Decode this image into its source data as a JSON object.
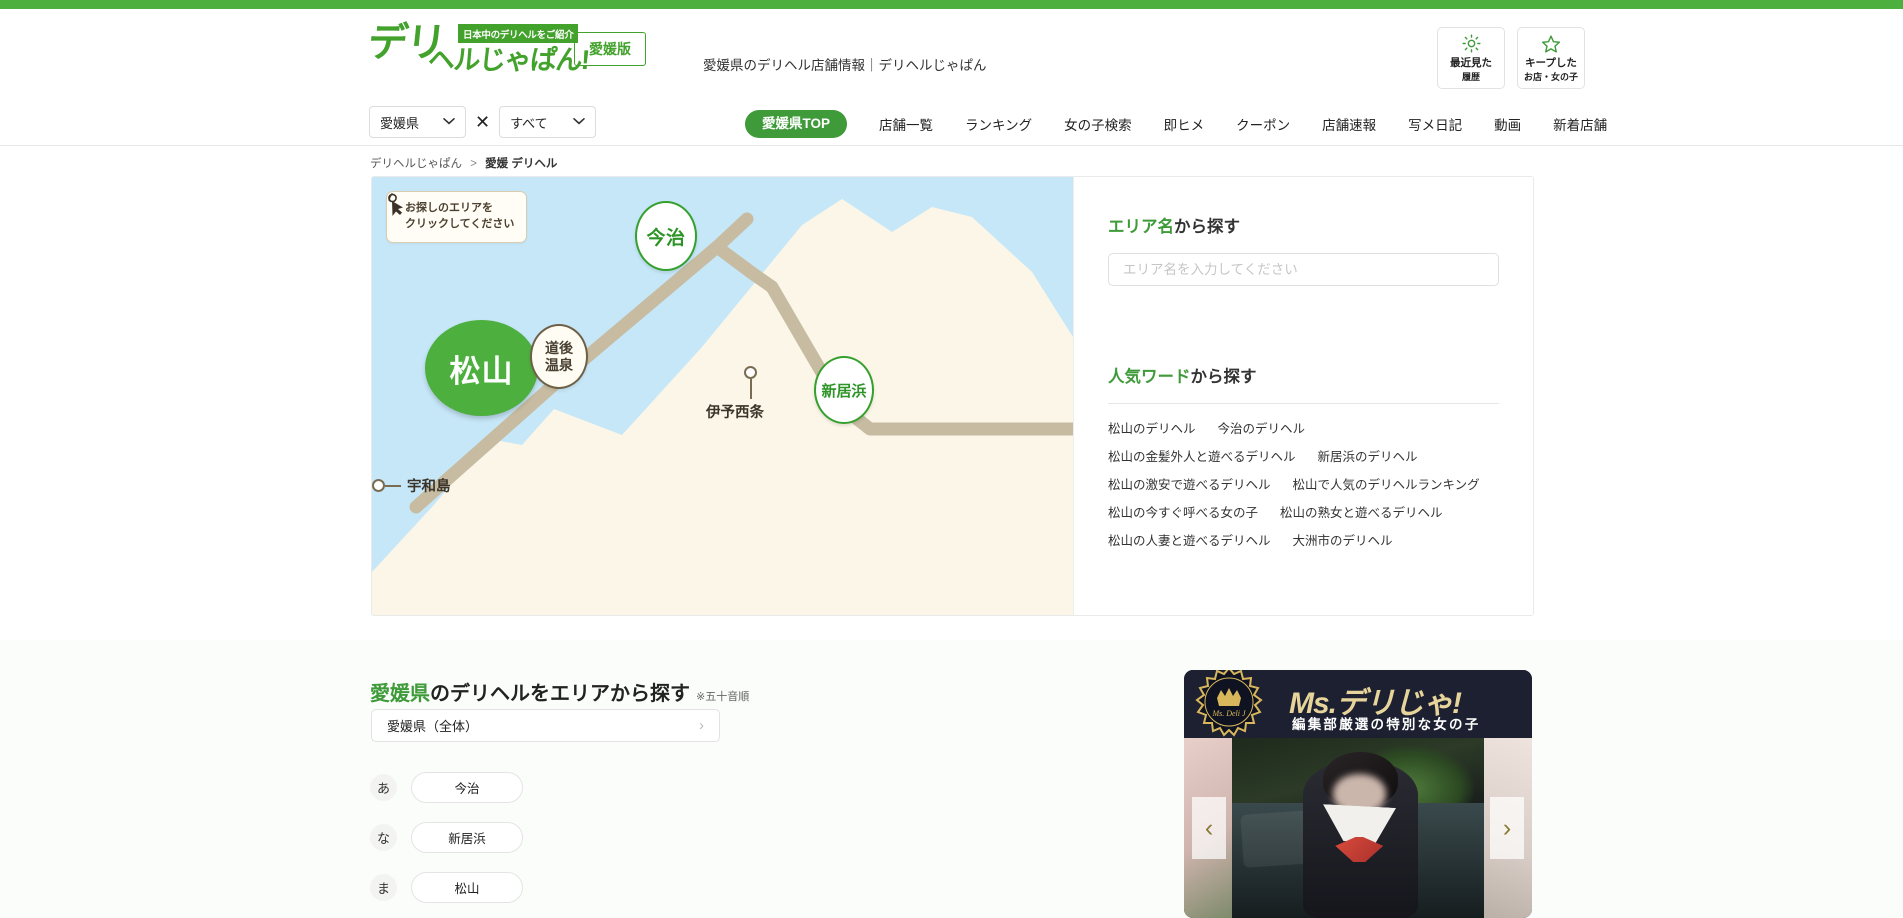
{
  "topbar": {
    "color": "#4CAF3E"
  },
  "header": {
    "logo_main": "デリ",
    "logo_tagline": "日本中のデリヘルをご紹介",
    "logo_sub": "ヘルじゃぱん!",
    "edition_badge": "愛媛版",
    "site_description": "愛媛県のデリヘル店舗情報｜デリヘルじゃぱん",
    "buttons": [
      {
        "icon": "sun-icon",
        "line1": "最近見た",
        "line2": "履歴"
      },
      {
        "icon": "star-icon",
        "line1": "キープした",
        "line2": "お店・女の子"
      }
    ]
  },
  "subnav": {
    "select_prefecture": "愛媛県",
    "separator": "✕",
    "select_category": "すべて",
    "pill": "愛媛県TOP",
    "links": [
      "店舗一覧",
      "ランキング",
      "女の子検索",
      "即ヒメ",
      "クーポン",
      "店舗速報",
      "写メ日記",
      "動画",
      "新着店舗"
    ]
  },
  "breadcrumb": {
    "root": "デリヘルじゃぱん",
    "separator": ">",
    "current": "愛媛 デリヘル"
  },
  "map": {
    "hint_line1": "お探しのエリアを",
    "hint_line2": "クリックしてください",
    "sea_color": "#C6E7F8",
    "land_color": "#FBF6E8",
    "road_color": "#C7BCA2",
    "accent_color": "#4CAF3E",
    "cities": [
      {
        "name": "matsuyama",
        "label": "松山",
        "style": "filled"
      },
      {
        "name": "imabari",
        "label": "今治",
        "style": "outline"
      },
      {
        "name": "niihama",
        "label": "新居浜",
        "style": "outline"
      },
      {
        "name": "dogo-onsen",
        "label_line1": "道後",
        "label_line2": "温泉",
        "style": "brown"
      }
    ],
    "pins": [
      {
        "name": "iyosaijo",
        "label": "伊予西条"
      },
      {
        "name": "uwajima",
        "label": "宇和島"
      }
    ]
  },
  "sidebar": {
    "area_heading_green": "エリア名",
    "area_heading_rest": "から探す",
    "area_placeholder": "エリア名を入力してください",
    "area_value": "",
    "popular_heading_green": "人気ワード",
    "popular_heading_rest": "から探す",
    "keywords": [
      [
        "松山のデリヘル",
        "今治のデリヘル"
      ],
      [
        "松山の金髪外人と遊べるデリヘル",
        "新居浜のデリヘル"
      ],
      [
        "松山の激安で遊べるデリヘル",
        "松山で人気のデリヘルランキング"
      ],
      [
        "松山の今すぐ呼べる女の子",
        "松山の熟女と遊べるデリヘル"
      ],
      [
        "松山の人妻と遊べるデリヘル",
        "大洲市のデリヘル"
      ]
    ]
  },
  "lower": {
    "title_green": "愛媛県",
    "title_rest": "のデリヘルをエリアから探す",
    "title_note": "※五十音順",
    "whole_button": "愛媛県（全体）",
    "whole_chevron": "›",
    "kana_rows": [
      {
        "kana": "あ",
        "area": "今治"
      },
      {
        "kana": "な",
        "area": "新居浜"
      },
      {
        "kana": "ま",
        "area": "松山"
      }
    ]
  },
  "ad": {
    "title": "Ms.デリじゃ!",
    "subtitle": "編集部厳選の特別な女の子",
    "prev": "‹",
    "next": "›",
    "seal_text": "Ms. Deli J"
  }
}
